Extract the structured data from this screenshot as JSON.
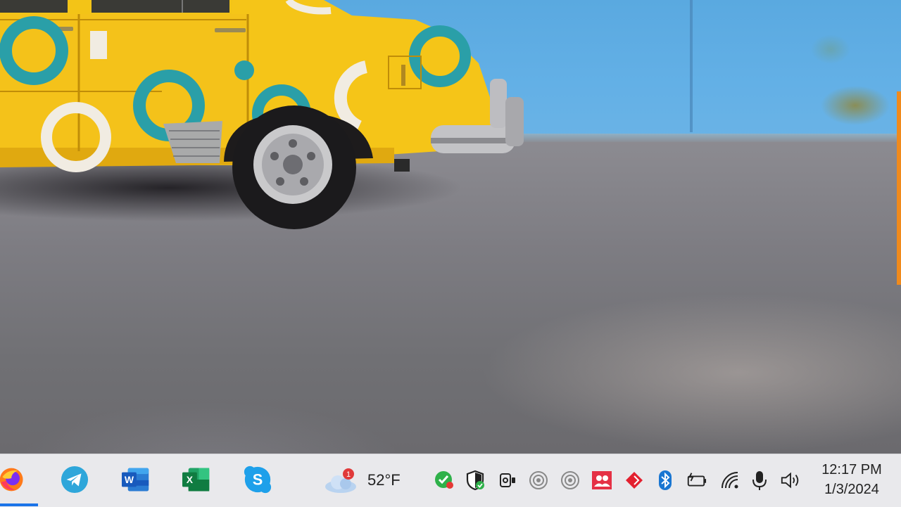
{
  "taskbar": {
    "apps": [
      {
        "name": "Firefox",
        "icon": "firefox-icon",
        "active": true
      },
      {
        "name": "Telegram",
        "icon": "telegram-icon"
      },
      {
        "name": "Microsoft Word",
        "icon": "word-icon",
        "letter": "W"
      },
      {
        "name": "Microsoft Excel",
        "icon": "excel-icon",
        "letter": "X"
      },
      {
        "name": "Skype",
        "icon": "skype-icon",
        "letter": "S"
      }
    ],
    "weather": {
      "icon": "cloud-icon",
      "badge": "1",
      "temperature": "52°F"
    },
    "tray_icons": [
      "security-check-icon",
      "defender-shield-icon",
      "camera-icon",
      "circle-app-icon",
      "circle-app-icon",
      "people-app-icon",
      "red-diamond-icon",
      "bluetooth-icon",
      "battery-icon",
      "wifi-icon",
      "microphone-icon",
      "speaker-icon"
    ],
    "clock": {
      "time": "12:17 PM",
      "date": "1/3/2024"
    }
  },
  "colors": {
    "taskbar_bg": "#e9e9ec",
    "accent": "#1a73e8",
    "car_yellow": "#f5c518",
    "wall_blue": "#62afe6",
    "circle_teal": "#2a9fa8"
  }
}
